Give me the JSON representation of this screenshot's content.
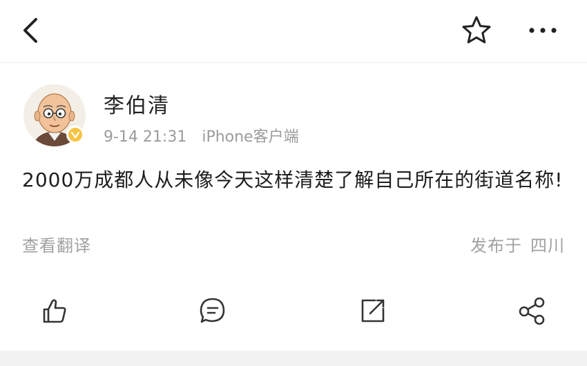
{
  "header": {
    "back_icon": "chevron-left-icon",
    "favorite_icon": "star-outline-icon",
    "more_icon": "more-horizontal-icon"
  },
  "post": {
    "author": "李伯清",
    "time": "9-14 21:31",
    "source": "iPhone客户端",
    "text": "2000万成都人从未像今天这样清楚了解自己所在的街道名称!",
    "translate_label": "查看翻译",
    "published_prefix": "发布于",
    "location": "四川",
    "verified": true
  },
  "actions": {
    "like_icon": "thumbs-up-icon",
    "comment_icon": "comment-icon",
    "repost_icon": "repost-icon",
    "share_icon": "share-icon"
  },
  "colors": {
    "text": "#1d1d1d",
    "muted": "#a0a0a0",
    "icon": "#333333",
    "badge": "#f6c343"
  }
}
